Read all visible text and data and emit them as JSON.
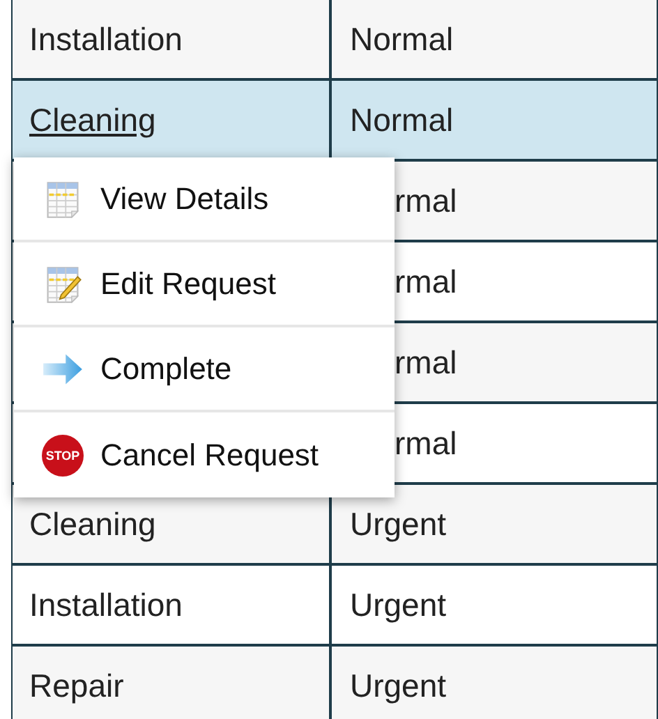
{
  "table": {
    "rows": [
      {
        "column_1": "Installation",
        "column_2": "Normal",
        "selected": false
      },
      {
        "column_1": "Cleaning",
        "column_2": "Normal",
        "selected": true
      },
      {
        "column_2": "rmal",
        "selected": false
      },
      {
        "column_2": "rmal",
        "selected": false
      },
      {
        "column_2": "rmal",
        "selected": false
      },
      {
        "column_2": "rmal",
        "selected": false
      },
      {
        "column_1": "Cleaning",
        "column_2": "Urgent",
        "selected": false
      },
      {
        "column_1": "Installation",
        "column_2": "Urgent",
        "selected": false
      },
      {
        "column_1": "Repair",
        "column_2": "Urgent",
        "selected": false
      }
    ]
  },
  "context_menu": {
    "items": [
      {
        "label": "View Details",
        "kind": "view"
      },
      {
        "label": "Edit Request",
        "kind": "edit"
      },
      {
        "label": "Complete",
        "kind": "arrow"
      },
      {
        "label": "Cancel Request",
        "kind": "stop",
        "icon_text": "STOP"
      }
    ]
  }
}
